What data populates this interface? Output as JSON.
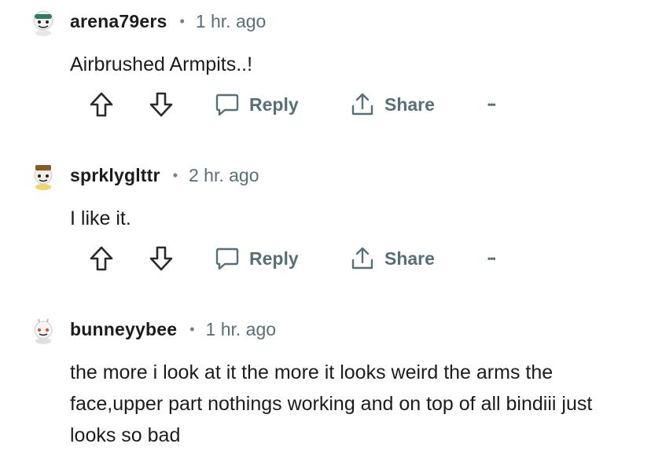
{
  "comments": [
    {
      "username": "arena79ers",
      "separator": "•",
      "time": "1 hr. ago",
      "body": "Airbrushed Armpits..!",
      "avatar_icon": "snoo-avatar-green-icon",
      "actions": {
        "reply": "Reply",
        "share": "Share",
        "more": "•••"
      }
    },
    {
      "username": "sprklyglttr",
      "separator": "•",
      "time": "2 hr. ago",
      "body": "I like it.",
      "avatar_icon": "snoo-avatar-hat-icon",
      "actions": {
        "reply": "Reply",
        "share": "Share",
        "more": "•••"
      }
    },
    {
      "username": "bunneyybee",
      "separator": "•",
      "time": "1 hr. ago",
      "body": "the more i look at it the more it looks weird the arms the face,upper part nothings working and on top of all bindiii just looks so bad",
      "avatar_icon": "snoo-avatar-bunny-icon"
    }
  ],
  "colors": {
    "meta": "#576f76",
    "text": "#1c1c1c"
  }
}
